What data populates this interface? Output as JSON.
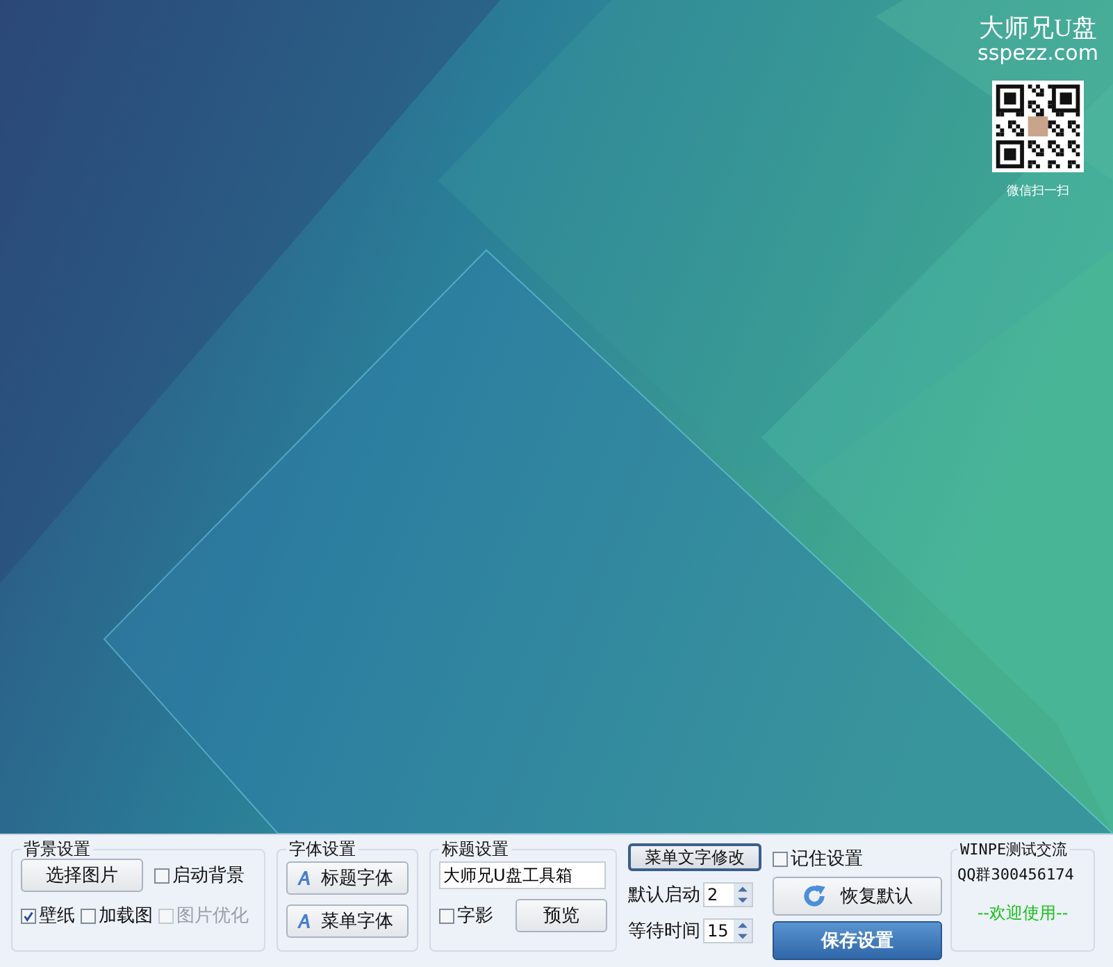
{
  "brand": {
    "title": "大师兄U盘",
    "site": "sspezz.com",
    "qr_caption": "微信扫一扫"
  },
  "background_settings": {
    "legend": "背景设置",
    "choose_button": "选择图片",
    "options": [
      {
        "label": "启动背景",
        "checked": false,
        "disabled": false
      },
      {
        "label": "壁纸",
        "checked": true,
        "disabled": false
      },
      {
        "label": "加载图",
        "checked": false,
        "disabled": false
      },
      {
        "label": "图片优化",
        "checked": false,
        "disabled": true
      }
    ]
  },
  "font_settings": {
    "legend": "字体设置",
    "buttons": [
      "标题字体",
      "菜单字体"
    ]
  },
  "title_settings": {
    "legend": "标题设置",
    "title_value": "大师兄U盘工具箱",
    "shadow": {
      "label": "字影",
      "checked": false
    },
    "preview_button": "预览"
  },
  "menu": {
    "edit_button": "菜单文字修改",
    "spinners": [
      {
        "label": "默认启动",
        "value": "2"
      },
      {
        "label": "等待时间",
        "value": "15"
      }
    ]
  },
  "actions": {
    "remember": {
      "label": "记住设置",
      "checked": false
    },
    "restore_button": "恢复默认",
    "save_button": "保存设置"
  },
  "community": {
    "legend": "WINPE测试交流",
    "qq": "QQ群300456174",
    "welcome": "--欢迎使用--"
  }
}
